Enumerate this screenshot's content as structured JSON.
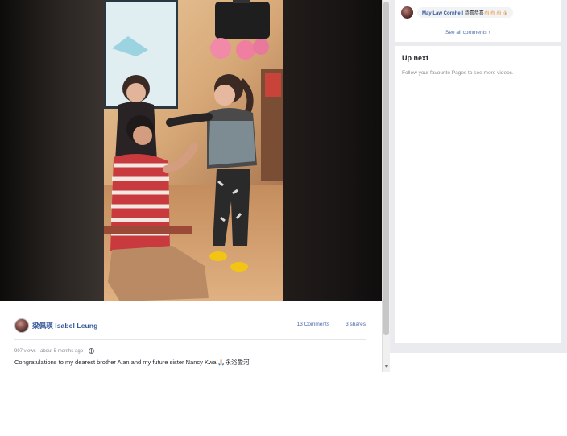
{
  "post": {
    "author_name": "梁佩瑛 Isabel Leung",
    "comments_count": "13 Comments",
    "shares_count": "3 shares",
    "meta_views": "997 views · about 5 months ago ·",
    "caption": "Congratulations to my dearest brother Alan and my future sister Nancy Kwai🙏🏻永浴愛河"
  },
  "comments_panel": {
    "commenter_name": "May Law Cornhell",
    "comment_text": "恭喜恭喜👏🏻👏🏻👏🏻👍🏻",
    "see_all_label": "See all comments"
  },
  "up_next": {
    "title": "Up next",
    "description": "Follow your favourite Pages to see more videos."
  },
  "icons": {
    "privacy": "globe-icon",
    "see_all": "chevron-right-icon",
    "scroll": "chevron-down-icon"
  },
  "colors": {
    "link_blue": "#365899",
    "panel_bg": "#e9ebee"
  }
}
